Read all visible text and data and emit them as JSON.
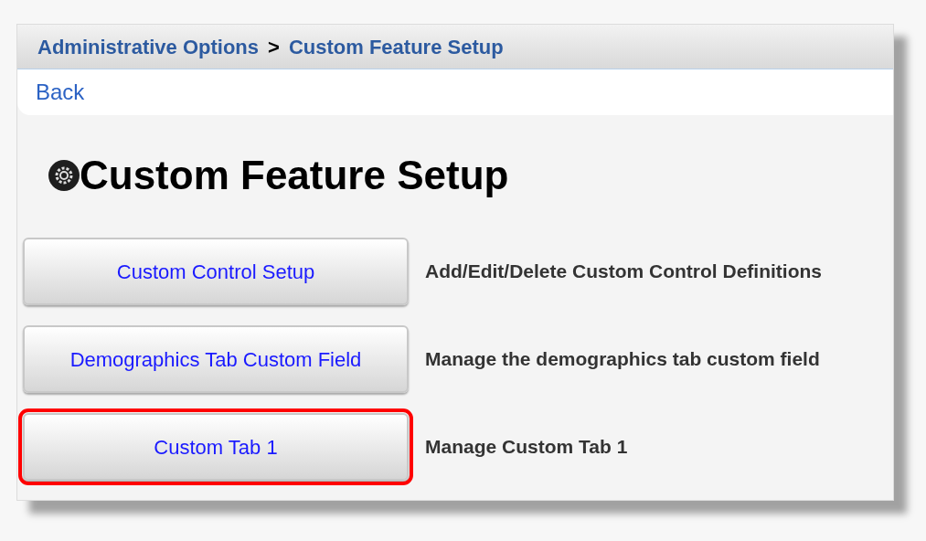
{
  "breadcrumb": [
    {
      "label": "Administrative Options"
    },
    {
      "label": "Custom Feature Setup"
    }
  ],
  "breadcrumb_separator": ">",
  "back_link": "Back",
  "page_title": "Custom Feature Setup",
  "features": [
    {
      "button": "Custom Control Setup",
      "description": "Add/Edit/Delete Custom Control Definitions",
      "highlighted": false
    },
    {
      "button": "Demographics Tab Custom Field",
      "description": "Manage the demographics tab custom field",
      "highlighted": false
    },
    {
      "button": "Custom Tab 1",
      "description": "Manage Custom Tab 1",
      "highlighted": true
    }
  ]
}
